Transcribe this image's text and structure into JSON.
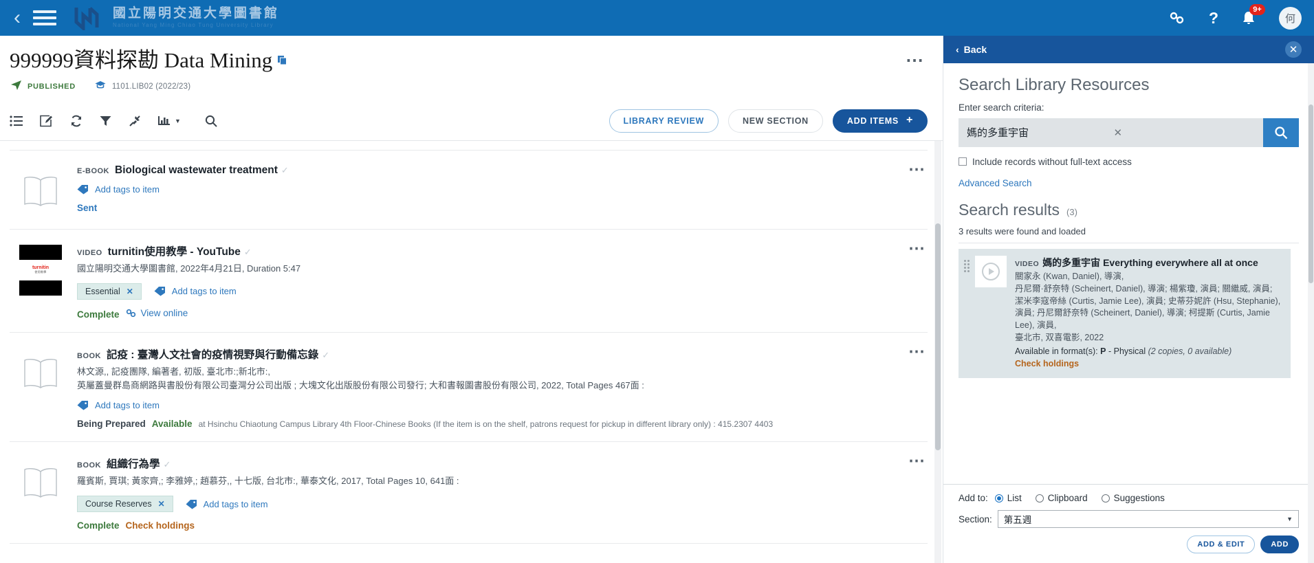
{
  "topbar": {
    "back_icon": "chevron-left-icon",
    "menu_icon": "hamburger-menu-icon",
    "brand_cn": "國立陽明交通大學圖書館",
    "brand_en": "National Yang Ming Chiao Tung University Library",
    "link_icon": "link-icon",
    "help_icon": "question-mark-icon",
    "bell_icon": "bell-icon",
    "notification_count": "9+",
    "avatar_initial": "何",
    "bg_color": "#0f6cb4",
    "badge_color": "#e2231a"
  },
  "course": {
    "title": "999999資料探勘 Data Mining",
    "copy_icon": "copy-icon",
    "status": "PUBLISHED",
    "status_icon": "send-icon",
    "code_icon": "graduation-cap-icon",
    "code": "1101.LIB02 (2022/23)",
    "more_icon": "ellipsis-icon"
  },
  "toolbar": {
    "tools": [
      {
        "name": "list-view-icon",
        "label": "List view"
      },
      {
        "name": "edit-icon",
        "label": "Edit"
      },
      {
        "name": "refresh-icon",
        "label": "Refresh"
      },
      {
        "name": "filter-icon",
        "label": "Filter"
      },
      {
        "name": "collapse-icon",
        "label": "Collapse"
      },
      {
        "name": "chart-icon",
        "label": "Analytics"
      },
      {
        "name": "search-icon",
        "label": "Search"
      }
    ],
    "library_review": "LIBRARY REVIEW",
    "new_section": "NEW SECTION",
    "add_items": "ADD ITEMS",
    "add_items_plus": "+"
  },
  "items": [
    {
      "kind": "E-BOOK",
      "title": "Biological wastewater treatment",
      "desc": "",
      "thumb": "book-icon",
      "tags": [],
      "add_tags": "Add tags to item",
      "status": "Sent",
      "status_type": "sent",
      "available": "",
      "note": "",
      "link": "",
      "check": ""
    },
    {
      "kind": "VIDEO",
      "title": "turnitin使用教學 - YouTube",
      "desc": "國立陽明交通大學圖書館, 2022年4月21日, Duration 5:47",
      "thumb": "video-thumbnail",
      "tags": [
        "Essential"
      ],
      "add_tags": "Add tags to item",
      "status": "Complete",
      "status_type": "complete",
      "available": "",
      "note": "",
      "link": "View online",
      "check": ""
    },
    {
      "kind": "BOOK",
      "title": "記疫 : 臺灣人文社會的疫情視野與行動備忘錄",
      "desc": "林文源,, 記疫團隊, 編著者, 初版, 臺北市:;新北市:,\n英屬蓋曼群島商網路與書股份有限公司臺灣分公司出版 ; 大塊文化出版股份有限公司發行; 大和書報圖書股份有限公司, 2022, Total Pages 467面 :",
      "thumb": "book-icon",
      "tags": [],
      "add_tags": "Add tags to item",
      "status": "Being Prepared",
      "status_type": "prepared",
      "available": "Available",
      "note": "at Hsinchu Chiaotung Campus Library 4th Floor-Chinese Books (If the item is on the shelf, patrons request for pickup in different library only) : 415.2307 4403",
      "link": "",
      "check": ""
    },
    {
      "kind": "BOOK",
      "title": "組織行為學",
      "desc": "羅賓斯, 賈琪; 黃家齊,; 李雅婷,; 趙慕芬,, 十七版, 台北市:, 華泰文化, 2017, Total Pages 10, 641面 :",
      "thumb": "book-icon",
      "tags": [
        "Course Reserves"
      ],
      "add_tags": "Add tags to item",
      "status": "Complete",
      "status_type": "complete",
      "available": "",
      "note": "",
      "link": "",
      "check": "Check holdings"
    }
  ],
  "panel": {
    "back": "Back",
    "back_icon": "chevron-left-icon",
    "close_icon": "close-icon",
    "heading": "Search Library Resources",
    "criteria_label": "Enter search criteria:",
    "search_value": "媽的多重宇宙",
    "search_placeholder": "Enter search criteria",
    "clear_icon": "clear-x-icon",
    "search_icon": "search-icon",
    "include_label": "Include records without full-text access",
    "include_checked": false,
    "advanced_search": "Advanced Search",
    "results_heading": "Search results",
    "results_count": "(3)",
    "results_loaded": "3 results were found and loaded",
    "results": [
      {
        "kind": "VIDEO",
        "title": "媽的多重宇宙 Everything everywhere all at once",
        "meta": "關家永 (Kwan, Daniel), 導演,\n丹尼爾·舒奈特 (Scheinert, Daniel), 導演; 楊紫瓊, 演員; 關繼威, 演員; 潔米李寇帝絲 (Curtis, Jamie Lee), 演員; 史蒂芬妮許 (Hsu, Stephanie), 演員; 丹尼爾舒奈特 (Scheinert, Daniel), 導演; 柯提斯 (Curtis, Jamie Lee), 演員,\n臺北市, 双喜電影, 2022",
        "available_prefix": "Available in format(s):",
        "available_format": "P",
        "available_rest": "- Physical",
        "available_copies": "(2 copies, 0 available)",
        "check_holdings": "Check holdings",
        "thumb": "play-icon"
      }
    ],
    "add_to_label": "Add to:",
    "add_to_options": [
      "List",
      "Clipboard",
      "Suggestions"
    ],
    "add_to_selected": "List",
    "section_label": "Section:",
    "section_value": "第五週",
    "add_edit_btn": "ADD & EDIT",
    "add_btn": "ADD",
    "header_color": "#17559c"
  }
}
